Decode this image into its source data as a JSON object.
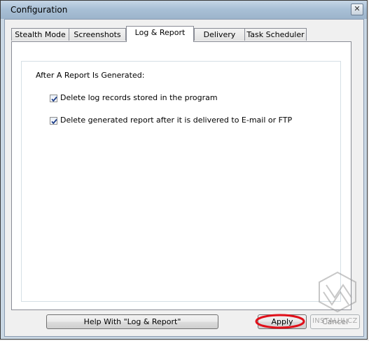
{
  "window": {
    "title": "Configuration",
    "close_glyph": "✕"
  },
  "tabs": [
    {
      "label": "Stealth Mode",
      "active": false
    },
    {
      "label": "Screenshots",
      "active": false
    },
    {
      "label": "Log & Report",
      "active": true
    },
    {
      "label": "Delivery",
      "active": false
    },
    {
      "label": "Task Scheduler",
      "active": false
    }
  ],
  "panel": {
    "section_label": "After A Report Is Generated:",
    "options": [
      {
        "label": "Delete log records stored in the program",
        "checked": true
      },
      {
        "label": "Delete generated report after it is delivered to E-mail or FTP",
        "checked": true
      }
    ]
  },
  "buttons": {
    "help_label": "Help With \"Log & Report\"",
    "apply_label": "Apply",
    "cancel_label": "Cancel"
  },
  "watermark": {
    "text": "INSTALUJ.CZ"
  },
  "colors": {
    "title_bar": "#a9c0d6",
    "annotation_red": "#e0101a",
    "check_blue": "#1f3f8a"
  }
}
